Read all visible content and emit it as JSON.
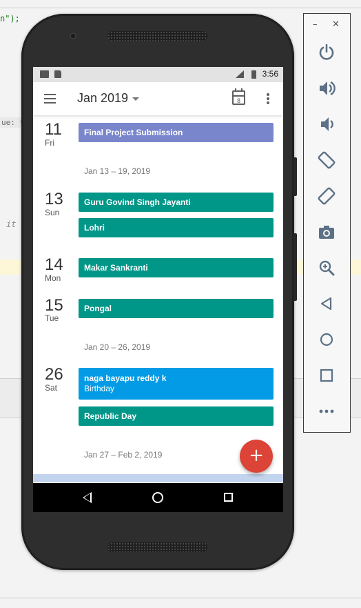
{
  "ide": {
    "code_top": "n\");",
    "code_key": "ue: t",
    "code_it": "it"
  },
  "status_bar": {
    "time": "3:56"
  },
  "app_bar": {
    "month": "Jan 2019",
    "today_day": "8"
  },
  "agenda": {
    "days": [
      {
        "num": "11",
        "name": "Fri"
      },
      {
        "num": "13",
        "name": "Sun"
      },
      {
        "num": "14",
        "name": "Mon"
      },
      {
        "num": "15",
        "name": "Tue"
      },
      {
        "num": "26",
        "name": "Sat"
      }
    ],
    "events": [
      {
        "title": "Final Project Submission",
        "color": "#7986cb"
      },
      {
        "title": "Guru Govind Singh Jayanti",
        "color": "#009688"
      },
      {
        "title": "Lohri",
        "color": "#009688"
      },
      {
        "title": "Makar Sankranti",
        "color": "#009688"
      },
      {
        "title": "Pongal",
        "color": "#009688"
      },
      {
        "title": "naga bayapu reddy k",
        "subtitle": "Birthday",
        "color": "#039be5"
      },
      {
        "title": "Republic Day",
        "color": "#009688"
      }
    ],
    "weeks": [
      "Jan 13 – 19, 2019",
      "Jan 20 – 26, 2019",
      "Jan 27 – Feb 2, 2019"
    ]
  },
  "fab": {
    "label": "+",
    "color": "#db4437"
  },
  "emulator_panel": {
    "minimize": "–",
    "close": "✕",
    "buttons": [
      "power-icon",
      "volume-up-icon",
      "volume-down-icon",
      "rotate-left-icon",
      "rotate-right-icon",
      "camera-icon",
      "zoom-icon",
      "back-icon",
      "home-icon",
      "overview-icon",
      "more-icon"
    ]
  }
}
